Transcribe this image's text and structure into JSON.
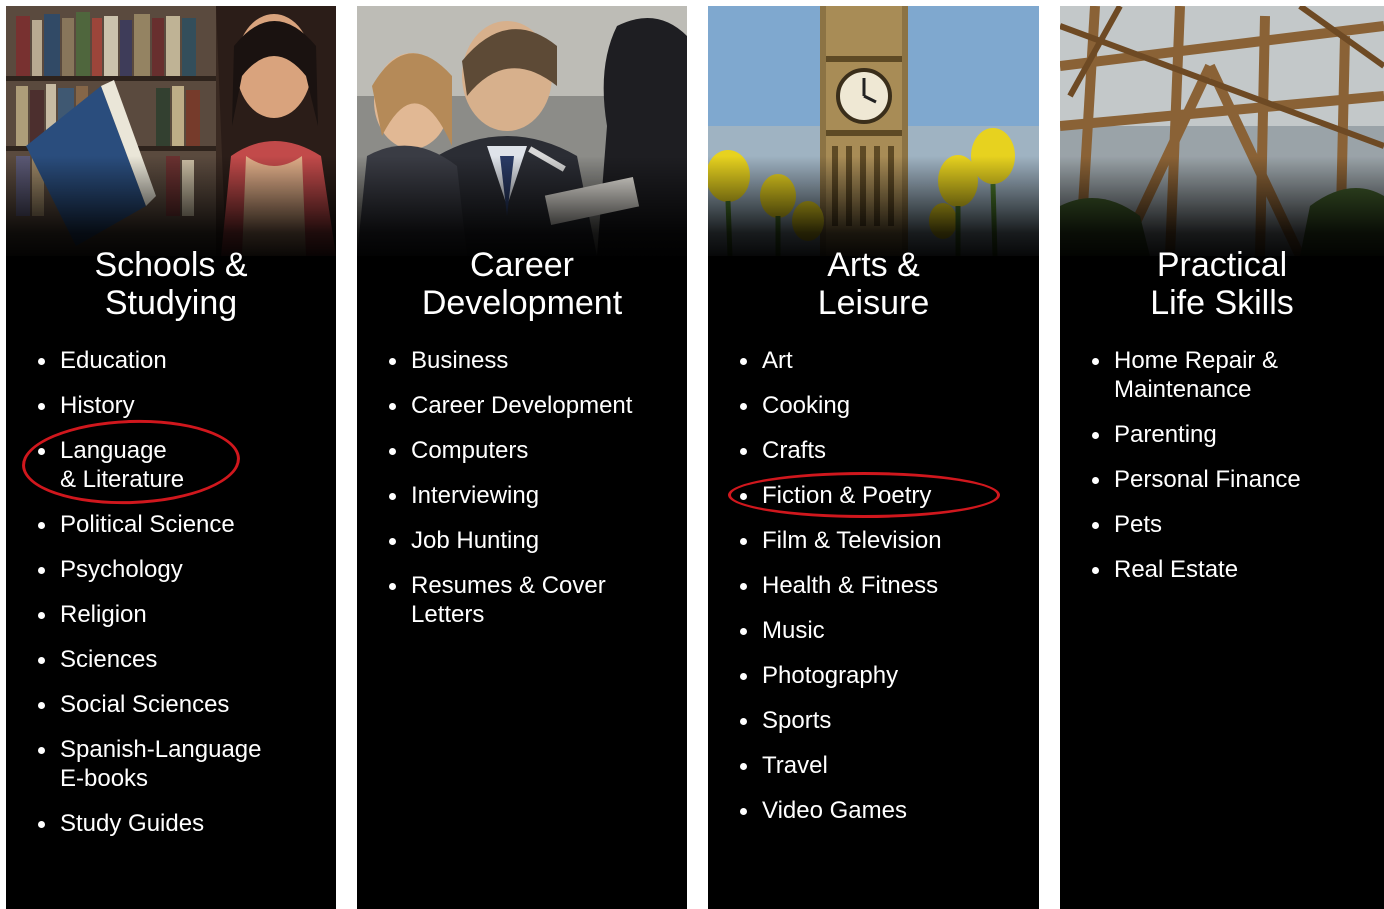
{
  "accent_color": "#d0171d",
  "columns": [
    {
      "heading": [
        "Schools &",
        "Studying"
      ],
      "image": "woman-reading-book-in-library",
      "items": [
        "Education",
        "History",
        "Language\n& Literature",
        "Political Science",
        "Psychology",
        "Religion",
        "Sciences",
        "Social Sciences",
        "Spanish-Language\nE-books",
        "Study Guides"
      ]
    },
    {
      "heading": [
        "Career",
        "Development"
      ],
      "image": "business-people-meeting",
      "items": [
        "Business",
        "Career Development",
        "Computers",
        "Interviewing",
        "Job Hunting",
        "Resumes & Cover\nLetters"
      ]
    },
    {
      "heading": [
        "Arts &",
        "Leisure"
      ],
      "image": "big-ben-clock-tower-with-tulips",
      "items": [
        "Art",
        "Cooking",
        "Crafts",
        "Fiction & Poetry",
        "Film & Television",
        "Health & Fitness",
        "Music",
        "Photography",
        "Sports",
        "Travel",
        "Video Games"
      ]
    },
    {
      "heading": [
        "Practical",
        "Life Skills"
      ],
      "image": "wooden-house-frame",
      "items": [
        "Home Repair &\nMaintenance",
        "Parenting",
        "Personal Finance",
        "Pets",
        "Real Estate"
      ]
    }
  ],
  "highlighted": [
    "Language & Literature",
    "Fiction & Poetry"
  ]
}
